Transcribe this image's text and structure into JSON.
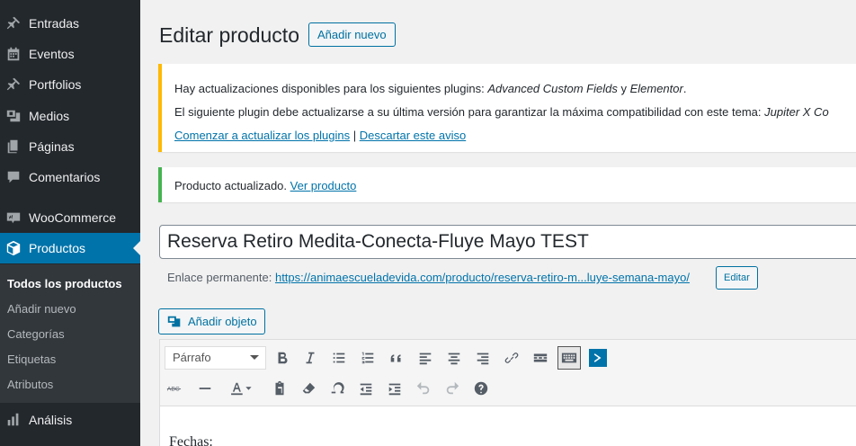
{
  "sidebar": {
    "items": [
      {
        "label": "Entradas",
        "icon": "pin-icon"
      },
      {
        "label": "Eventos",
        "icon": "calendar-icon"
      },
      {
        "label": "Portfolios",
        "icon": "pin-icon"
      },
      {
        "label": "Medios",
        "icon": "media-icon"
      },
      {
        "label": "Páginas",
        "icon": "pages-icon"
      },
      {
        "label": "Comentarios",
        "icon": "comment-icon"
      },
      {
        "label": "WooCommerce",
        "icon": "woo-icon"
      },
      {
        "label": "Productos",
        "icon": "box-icon"
      },
      {
        "label": "Análisis",
        "icon": "chart-icon"
      }
    ],
    "submenu": [
      "Todos los productos",
      "Añadir nuevo",
      "Categorías",
      "Etiquetas",
      "Atributos"
    ]
  },
  "page": {
    "title": "Editar producto",
    "add_new": "Añadir nuevo"
  },
  "notices": {
    "update_line1_prefix": "Hay actualizaciones disponibles para los siguientes plugins: ",
    "update_plugin1": "Advanced Custom Fields",
    "update_and": " y ",
    "update_plugin2": "Elementor",
    "update_period": ".",
    "update_line2_prefix": "El siguiente plugin debe actualizarse a su última versión para garantizar la máxima compatibilidad con este tema: ",
    "update_line2_plugin": "Jupiter X Co",
    "link_start": "Comenzar a actualizar los plugins",
    "separator": " | ",
    "link_dismiss": "Descartar este aviso",
    "success_text": "Producto actualizado. ",
    "success_link": "Ver producto"
  },
  "editor": {
    "title_value": "Reserva Retiro Medita-Conecta-Fluye Mayo TEST",
    "permalink_label": "Enlace permanente: ",
    "permalink_url": "https://animaescueladevida.com/producto/reserva-retiro-m...luye-semana-mayo/",
    "permalink_edit": "Editar",
    "add_media": "Añadir objeto",
    "format_select": "Párrafo",
    "content_first_line": "Fechas:"
  }
}
